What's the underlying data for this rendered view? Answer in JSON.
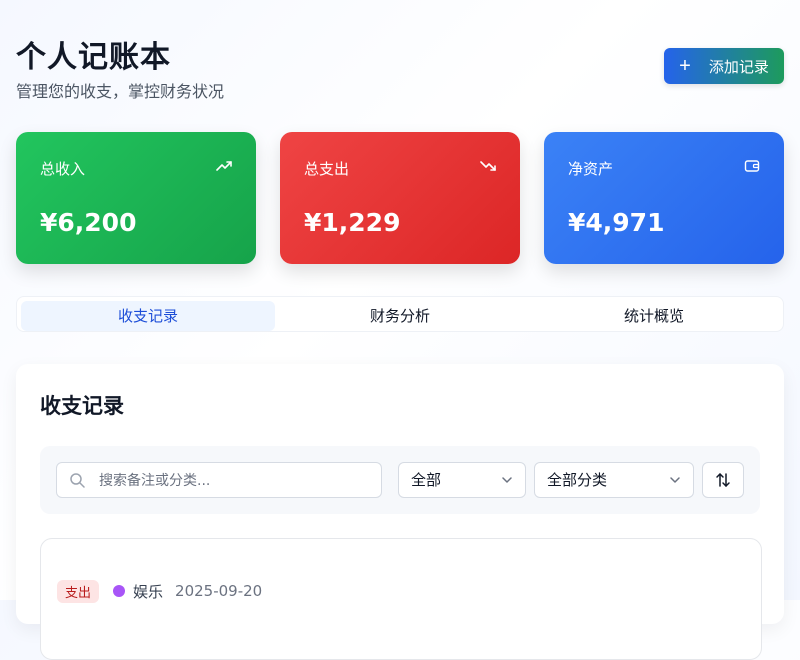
{
  "header": {
    "title": "个人记账本",
    "subtitle": "管理您的收支，掌控财务状况",
    "add_button": "添加记录"
  },
  "cards": {
    "income": {
      "label": "总收入",
      "value": "¥6,200",
      "icon": "trending-up-icon"
    },
    "expense": {
      "label": "总支出",
      "value": "¥1,229",
      "icon": "trending-down-icon"
    },
    "net": {
      "label": "净资产",
      "value": "¥4,971",
      "icon": "wallet-icon"
    }
  },
  "tabs": [
    {
      "label": "收支记录",
      "active": true
    },
    {
      "label": "财务分析",
      "active": false
    },
    {
      "label": "统计概览",
      "active": false
    }
  ],
  "records": {
    "title": "收支记录",
    "search": {
      "placeholder": "搜索备注或分类...",
      "value": ""
    },
    "type_filter": {
      "selected": "全部"
    },
    "category_filter": {
      "selected": "全部分类"
    },
    "items": [
      {
        "type": "支出",
        "category": "娱乐",
        "category_color": "#a855f7",
        "date": "2025-09-20"
      }
    ]
  },
  "colors": {
    "income": "#22c55e",
    "expense": "#ef4444",
    "net": "#3b82f6",
    "accent": "#2563eb"
  }
}
